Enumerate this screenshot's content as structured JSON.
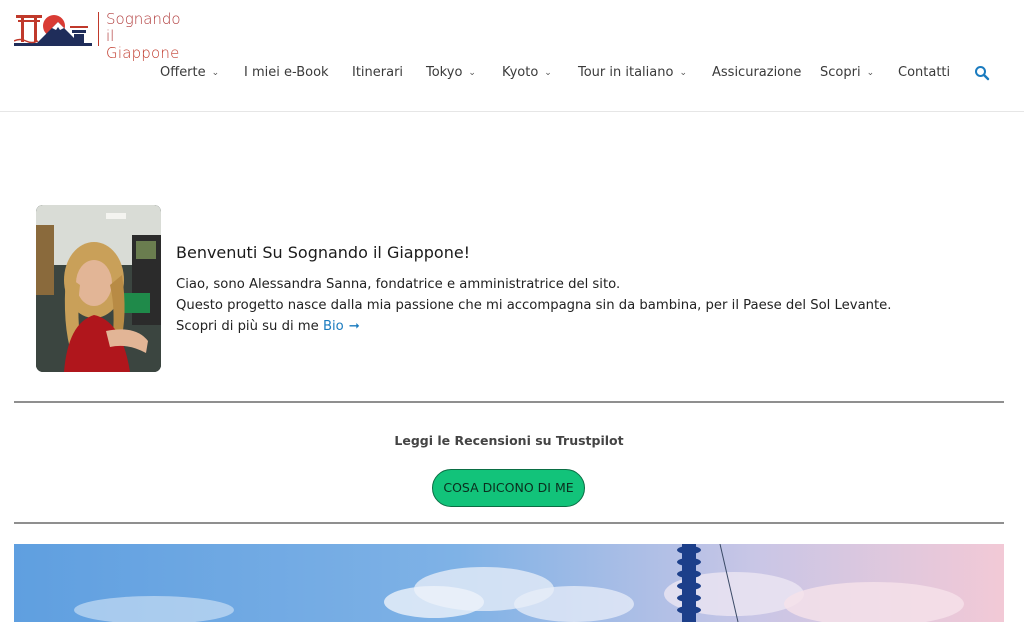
{
  "site": {
    "logo_line1": "Sognando il",
    "logo_line2": "Giappone"
  },
  "nav": {
    "items": [
      {
        "label": "Offerte",
        "has_dropdown": true
      },
      {
        "label": "I miei e-Book",
        "has_dropdown": false
      },
      {
        "label": "Itinerari",
        "has_dropdown": false
      },
      {
        "label": "Tokyo",
        "has_dropdown": true
      },
      {
        "label": "Kyoto",
        "has_dropdown": true
      },
      {
        "label": "Tour in italiano",
        "has_dropdown": true
      },
      {
        "label": "Assicurazione",
        "has_dropdown": false
      },
      {
        "label": "Scopri",
        "has_dropdown": true
      },
      {
        "label": "Contatti",
        "has_dropdown": false
      }
    ],
    "search_icon": "search-icon",
    "chevron_glyph": "⌄"
  },
  "intro": {
    "title": "Benvenuti Su Sognando il Giappone!",
    "line1": "Ciao, sono Alessandra Sanna, fondatrice e amministratrice del sito.",
    "line2": "Questo progetto nasce dalla mia passione che mi accompagna sin da bambina, per il Paese del Sol Levante.",
    "line3_prefix": "Scopri di più su di me",
    "bio_link": "Bio",
    "bio_arrow": "➞"
  },
  "trust": {
    "heading": "Leggi le Recensioni su Trustpilot",
    "button_label": "COSA DICONO DI ME"
  },
  "colors": {
    "brand_red": "#c0392b",
    "brand_navy": "#1f2d5a",
    "link_blue": "#1a7bbf",
    "cta_green": "#12c37a"
  }
}
